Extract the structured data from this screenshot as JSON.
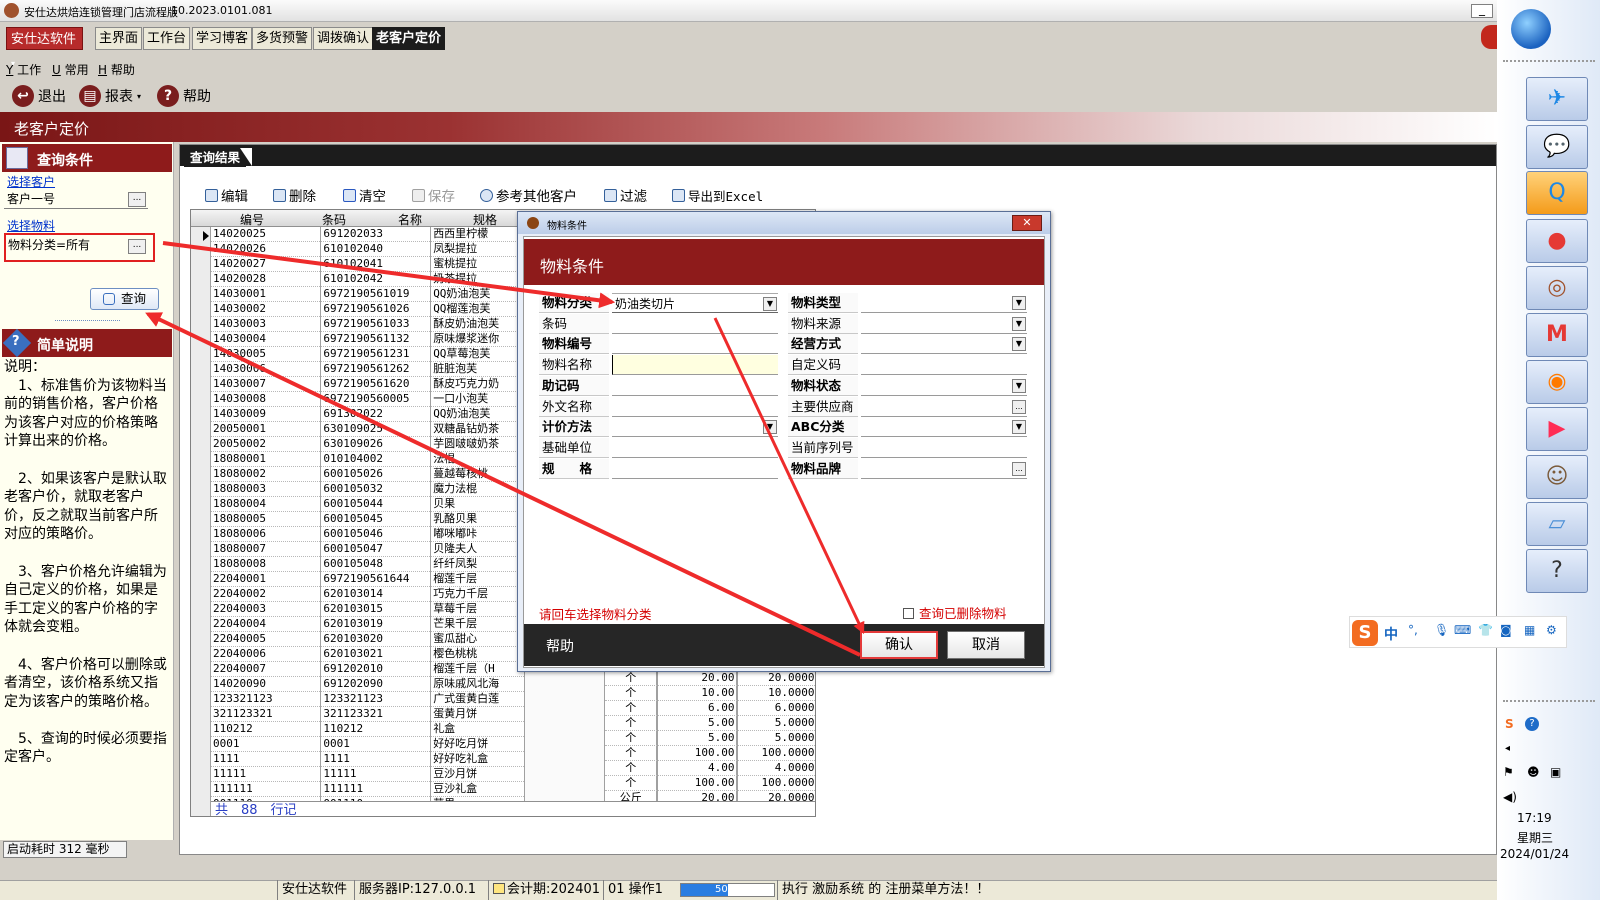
{
  "window": {
    "title": "安仕达烘焙连锁管理门店流程版",
    "version": "10.2023.0101.081"
  },
  "brand_btn": "安仕达软件",
  "tabs": [
    "主界面",
    "工作台",
    "学习博客",
    "多货预警",
    "调拨确认",
    "老客户定价"
  ],
  "menu": [
    "工作",
    "常用",
    "帮助"
  ],
  "menu_keys": [
    "Y",
    "U",
    "H"
  ],
  "toolbar": {
    "exit": "退出",
    "report": "报表",
    "help": "帮助"
  },
  "module_title": "老客户定价",
  "query": {
    "header": "查询条件",
    "select_customer": "选择客户",
    "customer_value": "客户一号",
    "select_material": "选择物料",
    "material_value": "物料分类=所有",
    "query_btn": "查询"
  },
  "help": {
    "header": "简单说明",
    "text": [
      "说明：",
      "　1、标准售价为该物料当前的销售价格，客户价格为该客户对应的价格策略计算出来的价格。",
      "",
      "　2、如果该客户是默认取老客户价，就取老客户价，反之就取当前客户所对应的策略价。",
      "",
      "　3、客户价格允许编辑为自己定义的价格，如果是手工定义的客户价格的字体就会变粗。",
      "",
      "　4、客户价格可以删除或者清空，该价格系统又指定为该客户的策略价格。",
      "",
      "　5、查询的时候必须要指定客户。"
    ]
  },
  "startup": "启动耗时 312 毫秒",
  "results_tab": "查询结果",
  "result_toolbar": [
    "编辑",
    "删除",
    "清空",
    "保存",
    "参考其他客户",
    "过滤",
    "导出到Excel"
  ],
  "columns": [
    "编号",
    "条码",
    "名称",
    "规格"
  ],
  "rows": [
    [
      "14020025",
      "691202033",
      "西西里柠檬"
    ],
    [
      "14020026",
      "610102040",
      "凤梨提拉"
    ],
    [
      "14020027",
      "610102041",
      "蜜桃提拉"
    ],
    [
      "14020028",
      "610102042",
      "奶茶提拉"
    ],
    [
      "14030001",
      "6972190561019",
      "QQ奶油泡芙"
    ],
    [
      "14030002",
      "6972190561026",
      "QQ榴莲泡芙"
    ],
    [
      "14030003",
      "6972190561033",
      "酥皮奶油泡芙"
    ],
    [
      "14030004",
      "6972190561132",
      "原味爆浆迷你"
    ],
    [
      "14030005",
      "6972190561231",
      "QQ草莓泡芙"
    ],
    [
      "14030006",
      "6972190561262",
      "脏脏泡芙"
    ],
    [
      "14030007",
      "6972190561620",
      "酥皮巧克力奶"
    ],
    [
      "14030008",
      "6972190560005",
      "一口小泡芙"
    ],
    [
      "14030009",
      "691302022",
      "QQ奶油泡芙"
    ],
    [
      "20050001",
      "630109025",
      "双糖晶钻奶茶"
    ],
    [
      "20050002",
      "630109026",
      "芋圆啵啵奶茶"
    ],
    [
      "18080001",
      "010104002",
      "法棍"
    ],
    [
      "18080002",
      "600105026",
      "蔓越莓核桃"
    ],
    [
      "18080003",
      "600105032",
      "魔力法棍"
    ],
    [
      "18080004",
      "600105044",
      "贝果"
    ],
    [
      "18080005",
      "600105045",
      "乳酪贝果"
    ],
    [
      "18080006",
      "600105046",
      "嘟咪嘟咔"
    ],
    [
      "18080007",
      "600105047",
      "贝隆夫人"
    ],
    [
      "18080008",
      "600105048",
      "纤纤凤梨"
    ],
    [
      "22040001",
      "6972190561644",
      "榴莲千层"
    ],
    [
      "22040002",
      "620103014",
      "巧克力千层"
    ],
    [
      "22040003",
      "620103015",
      "草莓千层"
    ],
    [
      "22040004",
      "620103019",
      "芒果千层"
    ],
    [
      "22040005",
      "620103020",
      "蜜瓜甜心"
    ],
    [
      "22040006",
      "620103021",
      "樱色桃桃"
    ],
    [
      "22040007",
      "691202010",
      "榴莲千层（H"
    ],
    [
      "14020090",
      "691202090",
      "原味戚风北海"
    ],
    [
      "123321123",
      "123321123",
      "广式蛋黄白莲"
    ],
    [
      "321123321",
      "321123321",
      "蛋黄月饼"
    ],
    [
      "110212",
      "110212",
      "礼盒"
    ],
    [
      "0001",
      "0001",
      "好好吃月饼"
    ],
    [
      "1111",
      "1111",
      "好好吃礼盒"
    ],
    [
      "11111",
      "11111",
      "豆沙月饼"
    ],
    [
      "111111",
      "111111",
      "豆沙礼盒"
    ],
    [
      "001110",
      "001110",
      "苹果"
    ]
  ],
  "lower_rows": [
    [
      "个",
      "20.00",
      "20.0000"
    ],
    [
      "个",
      "10.00",
      "10.0000"
    ],
    [
      "个",
      "6.00",
      "6.0000"
    ],
    [
      "个",
      "5.00",
      "5.0000"
    ],
    [
      "个",
      "5.00",
      "5.0000"
    ],
    [
      "个",
      "100.00",
      "100.0000"
    ],
    [
      "个",
      "4.00",
      "4.0000"
    ],
    [
      "个",
      "100.00",
      "100.0000"
    ],
    [
      "公斤",
      "20.00",
      "20.0000"
    ]
  ],
  "footer": "共　88　行记",
  "dialog": {
    "title": "物料条件",
    "header": "物料条件",
    "left": [
      {
        "label": "物料分类",
        "value": "奶油类切片",
        "bold": true,
        "dd": true
      },
      {
        "label": "条码",
        "value": "",
        "bold": false
      },
      {
        "label": "物料编号",
        "value": "",
        "bold": true
      },
      {
        "label": "物料名称",
        "value": "",
        "bold": false,
        "hl": true
      },
      {
        "label": "助记码",
        "value": "",
        "bold": true
      },
      {
        "label": "外文名称",
        "value": "",
        "bold": false
      },
      {
        "label": "计价方法",
        "value": "",
        "bold": true,
        "dd": true
      },
      {
        "label": "基础单位",
        "value": "",
        "bold": false
      },
      {
        "label": "规　　格",
        "value": "",
        "bold": true
      }
    ],
    "right": [
      {
        "label": "物料类型",
        "bold": true,
        "dd": true
      },
      {
        "label": "物料来源",
        "bold": false,
        "dd": true
      },
      {
        "label": "经营方式",
        "bold": true,
        "dd": true
      },
      {
        "label": "自定义码",
        "bold": false
      },
      {
        "label": "物料状态",
        "bold": true,
        "dd": true
      },
      {
        "label": "主要供应商",
        "bold": false,
        "dots": true
      },
      {
        "label": "ABC分类",
        "bold": true,
        "dd": true
      },
      {
        "label": "当前序列号",
        "bold": false
      },
      {
        "label": "物料品牌",
        "bold": true,
        "dots": true
      }
    ],
    "hint": "请回车选择物料分类",
    "checkbox": "查询已删除物料",
    "help": "帮助",
    "ok": "确认",
    "cancel": "取消"
  },
  "status": {
    "app": "安仕达软件",
    "server": "服务器IP:127.0.0.1",
    "period": "会计期:202401",
    "op": "01 操作1",
    "progress": "50%",
    "progress_value": 0.5,
    "message": "执行 激励系统 的 注册菜单方法！！"
  },
  "tray": {
    "time": "17:19",
    "day": "星期三",
    "date": "2024/01/24"
  },
  "ime": {
    "mode": "中"
  },
  "colors": {
    "brand": "#8e1b1b",
    "selection": "#0a246a",
    "hint": "#d40000"
  }
}
